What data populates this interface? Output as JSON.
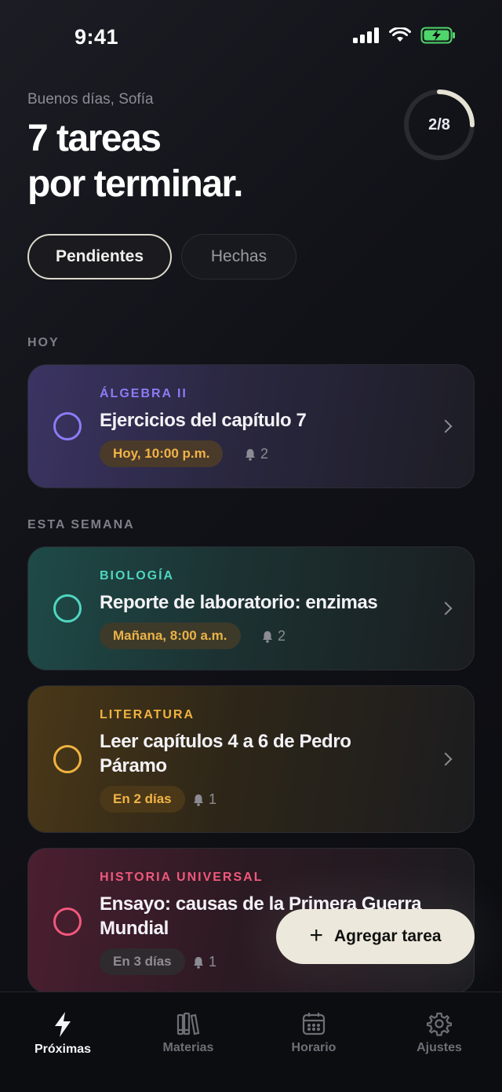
{
  "status": {
    "time": "9:41"
  },
  "header": {
    "greeting": "Buenos días, Sofía",
    "headline_line1": "7 tareas",
    "headline_line2": "por terminar.",
    "progress_label": "2/8",
    "progress_fraction": 0.25
  },
  "filters": {
    "pending": "Pendientes",
    "done": "Hechas"
  },
  "sections": {
    "today": "HOY",
    "week": "ESTA SEMANA"
  },
  "tasks": [
    {
      "subject": "ÁLGEBRA II",
      "title_line1": "Ejercicios del capítulo 7",
      "title_line2": "",
      "due": "Hoy, 10:00 p.m.",
      "reminders": "2",
      "accent": "#8b7cf6"
    },
    {
      "subject": "BIOLOGÍA",
      "title_line1": "Reporte de laboratorio: enzimas",
      "title_line2": "",
      "due": "Mañana, 8:00 a.m.",
      "reminders": "2",
      "accent": "#4fd6c1"
    },
    {
      "subject": "LITERATURA",
      "title_line1": "Leer capítulos 4 a 6 de Pedro",
      "title_line2": "Páramo",
      "due": "En 2 días",
      "reminders": "1",
      "accent": "#f0b340"
    },
    {
      "subject": "HISTORIA UNIVERSAL",
      "title_line1": "Ensayo: causas de la Primera Guerra",
      "title_line2": "Mundial",
      "due": "En 3 días",
      "reminders": "1",
      "accent": "#f0587c"
    }
  ],
  "fab": {
    "label": "Agregar tarea"
  },
  "tabs": [
    {
      "label": "Próximas",
      "icon": "bolt-icon"
    },
    {
      "label": "Materias",
      "icon": "books-icon"
    },
    {
      "label": "Horario",
      "icon": "calendar-icon"
    },
    {
      "label": "Ajustes",
      "icon": "gear-icon"
    }
  ]
}
